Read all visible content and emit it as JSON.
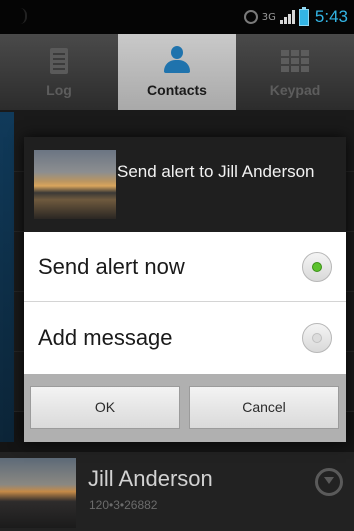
{
  "status_bar": {
    "time": "5:43",
    "network_label": "3G",
    "icons": [
      "alarm-icon",
      "network-3g-icon",
      "signal-icon",
      "battery-icon"
    ]
  },
  "tabs": [
    {
      "label": "Log",
      "icon": "log-icon",
      "active": false
    },
    {
      "label": "Contacts",
      "icon": "contacts-icon",
      "active": true
    },
    {
      "label": "Keypad",
      "icon": "keypad-icon",
      "active": false
    }
  ],
  "dialog": {
    "title": "Send alert to Jill Anderson",
    "options": [
      {
        "label": "Send alert now",
        "selected": true
      },
      {
        "label": "Add message",
        "selected": false
      }
    ],
    "ok_label": "OK",
    "cancel_label": "Cancel"
  },
  "contact": {
    "name": "Jill Anderson",
    "number": "120•3•26882"
  },
  "colors": {
    "accent": "#33b5e5",
    "radio_selected": "#5cc22d"
  }
}
